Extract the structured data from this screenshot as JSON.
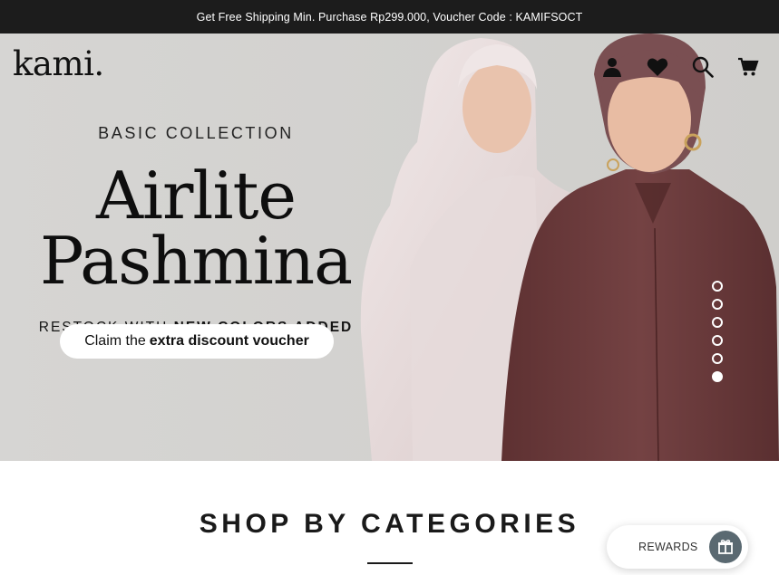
{
  "announcement": {
    "text": "Get Free Shipping Min. Purchase Rp299.000, Voucher Code : KAMIFSOCT"
  },
  "header": {
    "logo": "kami.",
    "icons": [
      "account-icon",
      "wishlist-heart-icon",
      "search-icon",
      "cart-icon"
    ]
  },
  "hero": {
    "collection": "BASIC COLLECTION",
    "headline_line1": "Airlite",
    "headline_line2": "Pashmina",
    "restock_prefix": "RESTOCK WITH",
    "restock_bold": "NEW COLORS ADDED",
    "cta_prefix": "Claim the",
    "cta_bold": "extra discount voucher",
    "slides_total": 6,
    "active_slide": 6
  },
  "sections": {
    "shop_title": "SHOP BY CATEGORIES"
  },
  "rewards": {
    "label": "REWARDS"
  },
  "colors": {
    "announcement_bg": "#1c1c1c",
    "hero_bg": "#d4d3d1",
    "model_left_scarf": "#e8dcdc",
    "model_right_shirt": "#6b3b3c",
    "rewards_icon_bg": "#5a6971"
  }
}
